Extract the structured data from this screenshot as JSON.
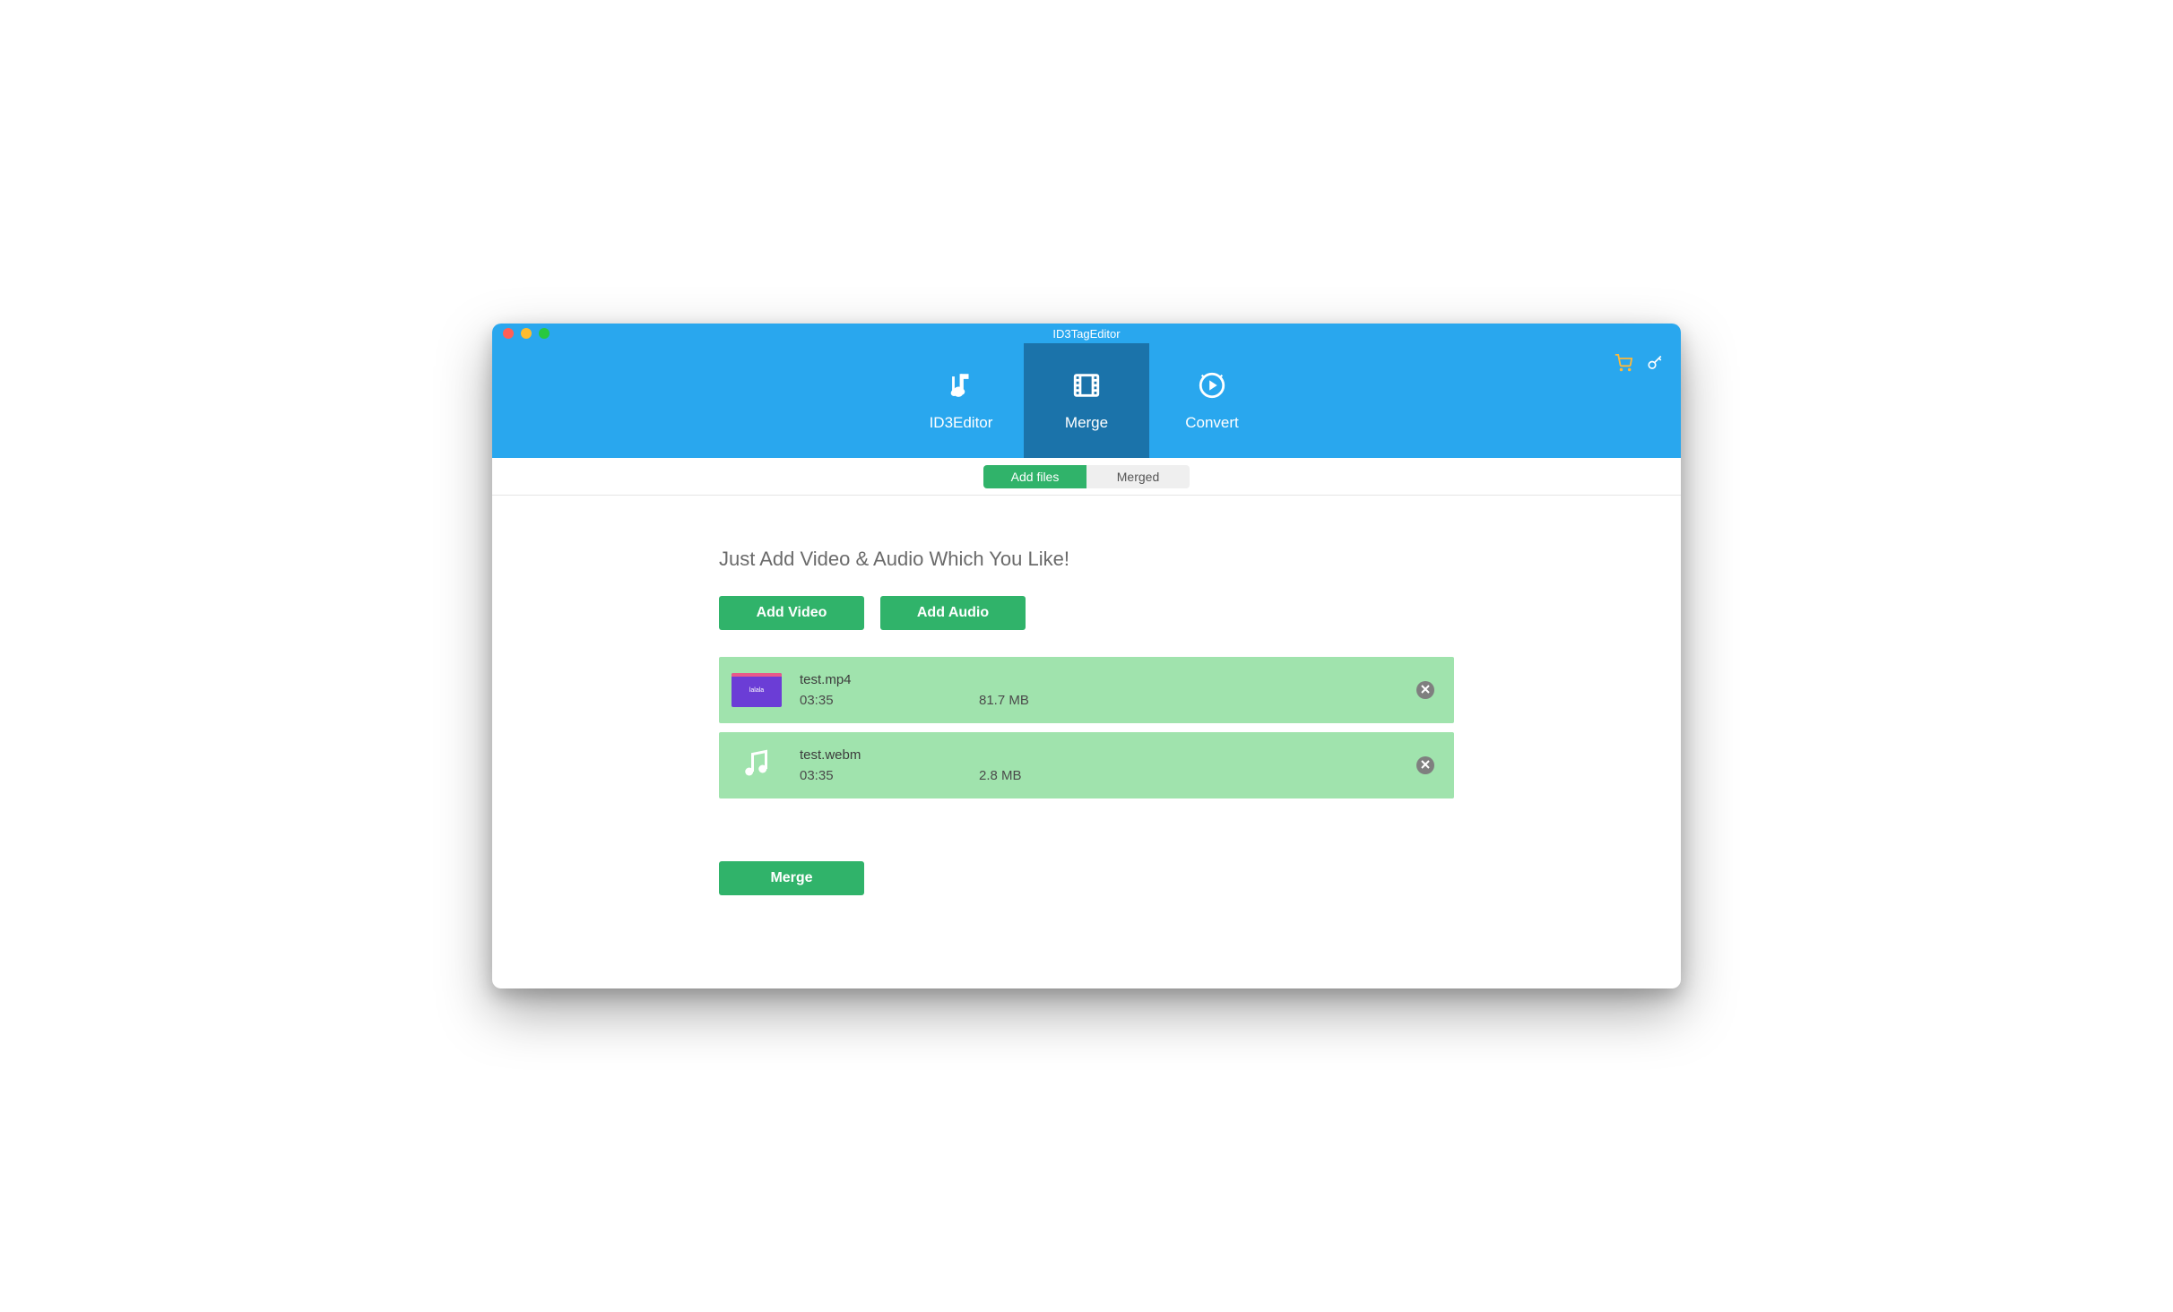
{
  "window": {
    "title": "ID3TagEditor"
  },
  "nav": {
    "tabs": [
      {
        "label": "ID3Editor",
        "icon": "music"
      },
      {
        "label": "Merge",
        "icon": "film",
        "active": true
      },
      {
        "label": "Convert",
        "icon": "convert"
      }
    ]
  },
  "subtabs": {
    "items": [
      {
        "label": "Add files",
        "active": true
      },
      {
        "label": "Merged",
        "active": false
      }
    ]
  },
  "main": {
    "heading": "Just Add Video & Audio Which You Like!",
    "add_video_label": "Add Video",
    "add_audio_label": "Add Audio",
    "merge_label": "Merge"
  },
  "files": [
    {
      "name": "test.mp4",
      "duration": "03:35",
      "size": "81.7 MB",
      "type": "video"
    },
    {
      "name": "test.webm",
      "duration": "03:35",
      "size": "2.8 MB",
      "type": "audio"
    }
  ]
}
